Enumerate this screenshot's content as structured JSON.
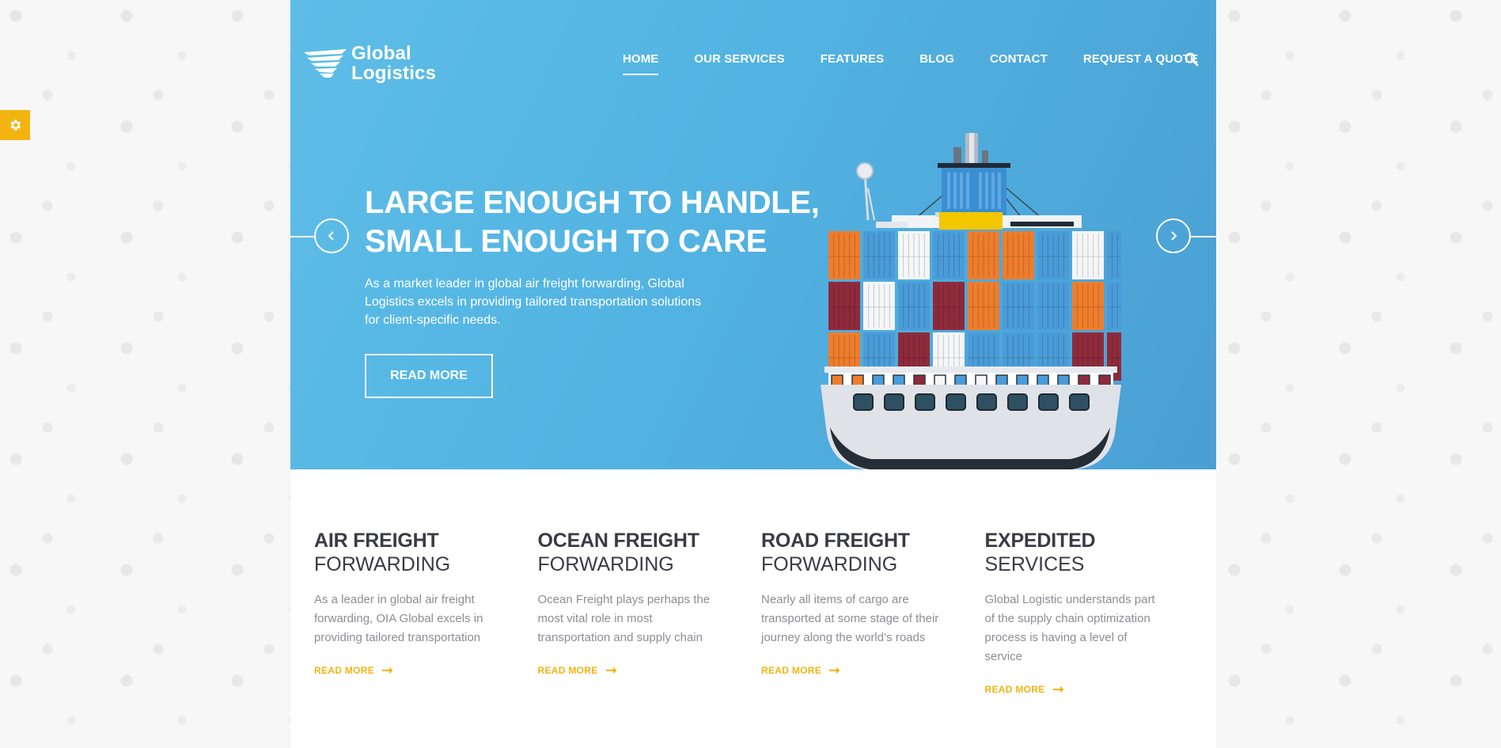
{
  "brand": {
    "line1": "Global",
    "line2": "Logistics",
    "accent_color": "#f3b411",
    "hero_color": "#52b3e2"
  },
  "nav": {
    "items": [
      {
        "label": "HOME",
        "active": true
      },
      {
        "label": "OUR SERVICES",
        "active": false
      },
      {
        "label": "FEATURES",
        "active": false
      },
      {
        "label": "BLOG",
        "active": false
      },
      {
        "label": "CONTACT",
        "active": false
      },
      {
        "label": "REQUEST A QUOTE",
        "active": false
      }
    ],
    "search_icon": "search-icon"
  },
  "settings": {
    "icon": "gear-icon"
  },
  "hero": {
    "title_line1": "LARGE ENOUGH TO HANDLE,",
    "title_line2": "SMALL ENOUGH TO CARE",
    "description": "As a market leader in global air freight forwarding, Global Logistics excels in providing tailored transportation solutions for client-specific needs.",
    "button_label": "READ MORE",
    "prev_icon": "chevron-left-icon",
    "next_icon": "chevron-right-icon"
  },
  "services": [
    {
      "title": "AIR FREIGHT",
      "subtitle": "FORWARDING",
      "description": "As a leader in global air freight forwarding, OIA Global excels in providing tailored transportation",
      "link": "READ MORE"
    },
    {
      "title": "OCEAN FREIGHT",
      "subtitle": "FORWARDING",
      "description": "Ocean Freight plays perhaps the most vital role in most transportation and supply chain",
      "link": "READ MORE"
    },
    {
      "title": "ROAD FREIGHT",
      "subtitle": "FORWARDING",
      "description": "Nearly all items of cargo are transported at some stage of their journey along the world’s roads",
      "link": "READ MORE"
    },
    {
      "title": "EXPEDITED",
      "subtitle": "SERVICES",
      "description": "Global Logistic understands part of the supply chain optimization process is having a level of service",
      "link": "READ MORE"
    }
  ]
}
